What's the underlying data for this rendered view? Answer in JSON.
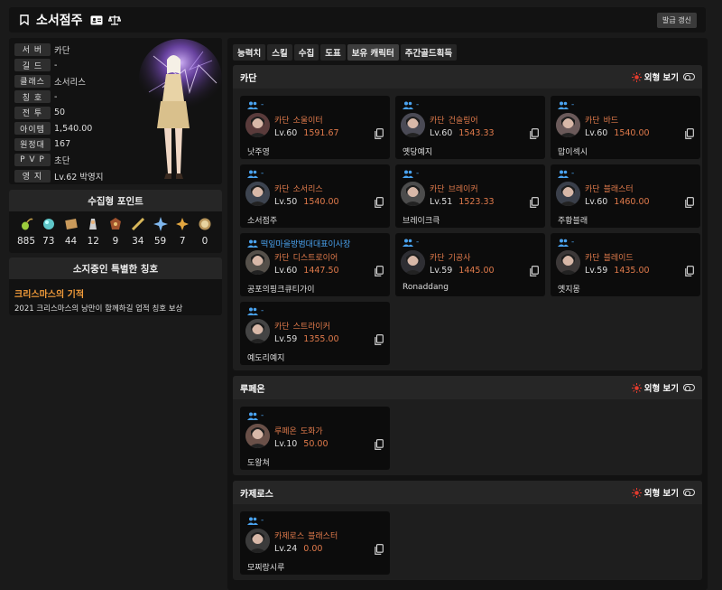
{
  "header": {
    "title": "소서점주",
    "refresh_label": "발급 갱신"
  },
  "profile": {
    "rows": [
      {
        "label": "서 버",
        "value": "카단"
      },
      {
        "label": "길 드",
        "value": "-"
      },
      {
        "label": "클래스",
        "value": "소서리스"
      },
      {
        "label": "칭 호",
        "value": "-"
      },
      {
        "label": "전 투",
        "value": "50"
      },
      {
        "label": "아이템",
        "value": "1,540.00"
      },
      {
        "label": "원정대",
        "value": "167"
      },
      {
        "label": "P V P",
        "value": "초단"
      },
      {
        "label": "영 지",
        "value": "Lv.62 박영지"
      }
    ]
  },
  "collection": {
    "title": "수집형 포인트",
    "points": [
      {
        "icon": "mokoko-seed-icon",
        "value": "885"
      },
      {
        "icon": "island-heart-icon",
        "value": "73"
      },
      {
        "icon": "great-art-icon",
        "value": "44"
      },
      {
        "icon": "giant-heart-icon",
        "value": "12"
      },
      {
        "icon": "ignea-token-icon",
        "value": "9"
      },
      {
        "icon": "world-tree-leaf-icon",
        "value": "34"
      },
      {
        "icon": "omnium-star-icon",
        "value": "59"
      },
      {
        "icon": "orpheus-star-icon",
        "value": "7"
      },
      {
        "icon": "sea-bounty-icon",
        "value": "0"
      }
    ]
  },
  "special_title": {
    "heading": "소지중인 특별한 칭호",
    "name": "크리스마스의 기적",
    "description": "2021 크리스마스의 낭만이 함께하길 업적 칭호 보상"
  },
  "tabs": [
    "능력치",
    "스킬",
    "수집",
    "도표",
    "보유 캐릭터",
    "주간골드획득"
  ],
  "active_tab": "보유 캐릭터",
  "appearance_toggle_label": "외형 보기",
  "servers": [
    {
      "name": "카단",
      "characters": [
        {
          "guild": "-",
          "server": "카단",
          "class": "소울이터",
          "level": "Lv.60",
          "item_level": "1591.67",
          "name": "낫주영"
        },
        {
          "guild": "-",
          "server": "카단",
          "class": "건슬링어",
          "level": "Lv.60",
          "item_level": "1543.33",
          "name": "옛당예지"
        },
        {
          "guild": "-",
          "server": "카단",
          "class": "바드",
          "level": "Lv.60",
          "item_level": "1540.00",
          "name": "맙이섹시"
        },
        {
          "guild": "-",
          "server": "카단",
          "class": "소서리스",
          "level": "Lv.50",
          "item_level": "1540.00",
          "name": "소서점주"
        },
        {
          "guild": "-",
          "server": "카단",
          "class": "브레이커",
          "level": "Lv.51",
          "item_level": "1523.33",
          "name": "브레이크큭"
        },
        {
          "guild": "-",
          "server": "카단",
          "class": "블래스터",
          "level": "Lv.60",
          "item_level": "1460.00",
          "name": "주황블래"
        },
        {
          "guild": "떡잎마을방범대대표이사장",
          "server": "카단",
          "class": "디스트로이어",
          "level": "Lv.60",
          "item_level": "1447.50",
          "name": "공포의핑크큐티가이"
        },
        {
          "guild": "-",
          "server": "카단",
          "class": "기공사",
          "level": "Lv.59",
          "item_level": "1445.00",
          "name": "Ronaddang"
        },
        {
          "guild": "-",
          "server": "카단",
          "class": "블레이드",
          "level": "Lv.59",
          "item_level": "1435.00",
          "name": "옛지몽"
        },
        {
          "guild": "-",
          "server": "카단",
          "class": "스트라이커",
          "level": "Lv.59",
          "item_level": "1355.00",
          "name": "예도리예지"
        }
      ]
    },
    {
      "name": "루페온",
      "characters": [
        {
          "guild": "-",
          "server": "루페온",
          "class": "도화가",
          "level": "Lv.10",
          "item_level": "50.00",
          "name": "도왕쳐"
        }
      ]
    },
    {
      "name": "카제로스",
      "characters": [
        {
          "guild": "-",
          "server": "카제로스",
          "class": "블래스터",
          "level": "Lv.24",
          "item_level": "0.00",
          "name": "모찌랑시루"
        }
      ]
    }
  ],
  "colors": {
    "accent_orange": "#e07a4b",
    "guild_blue": "#4aa3f0",
    "title_orange": "#f39c3a",
    "toggle_red": "#e23b2e"
  }
}
